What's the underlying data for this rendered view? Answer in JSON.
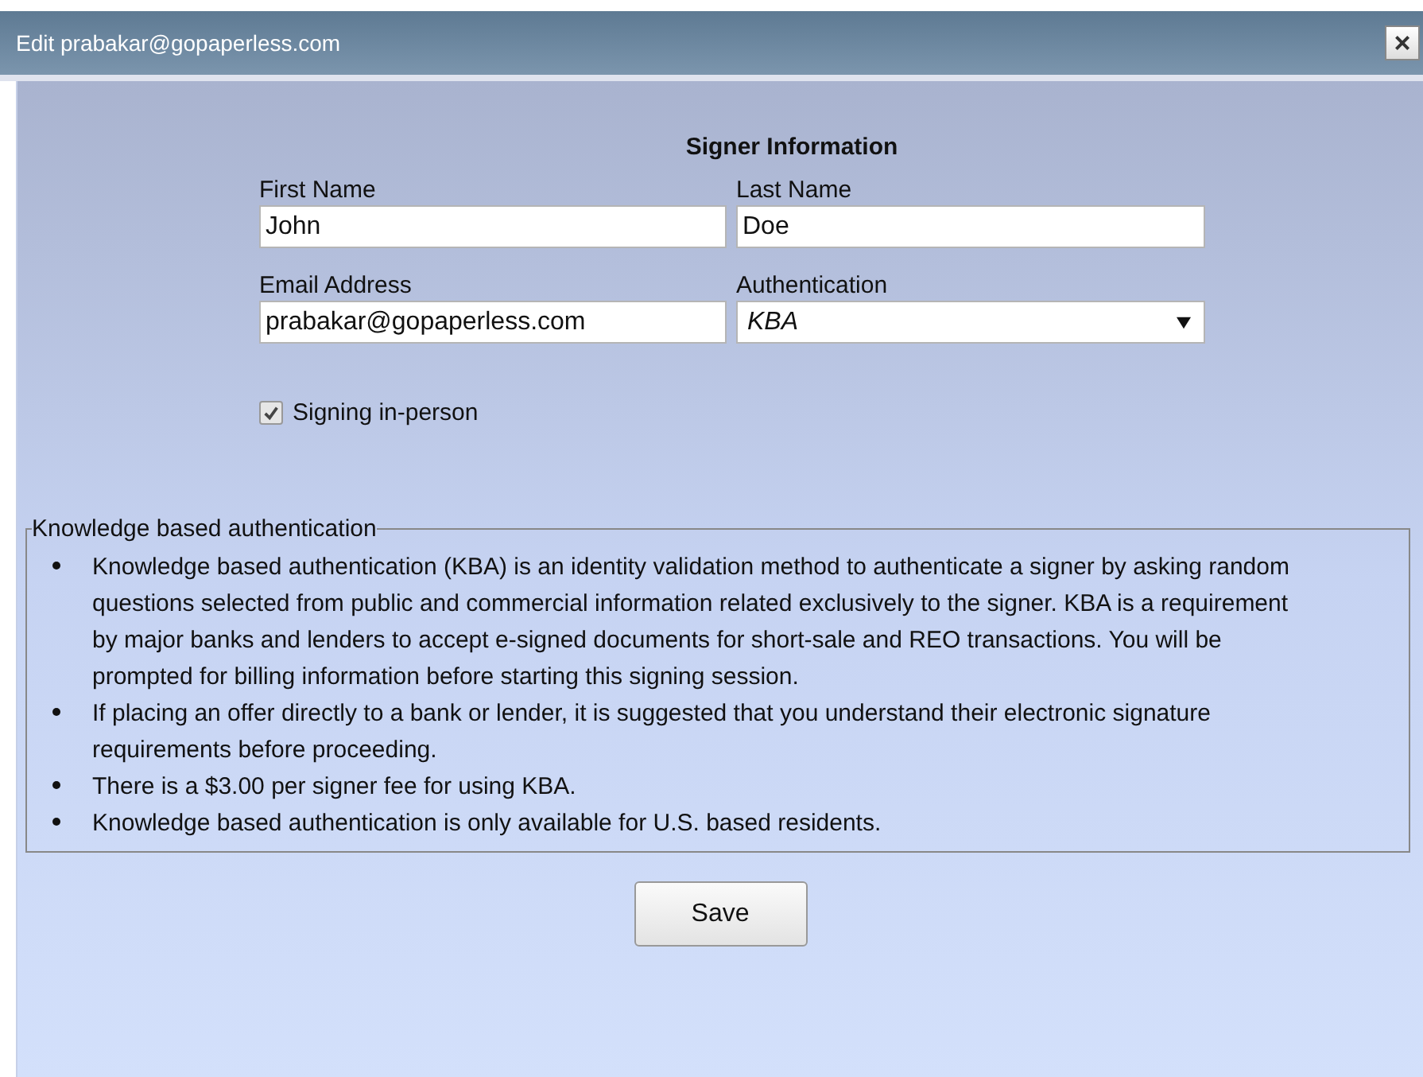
{
  "window": {
    "title": "Edit prabakar@gopaperless.com",
    "close": "×"
  },
  "section_title": "Signer Information",
  "fields": [
    {
      "label": "First Name",
      "value": "John",
      "kind": "text"
    },
    {
      "label": "Last Name",
      "value": "Doe",
      "kind": "text"
    },
    {
      "label": "Email Address",
      "value": "prabakar@gopaperless.com",
      "kind": "text"
    },
    {
      "label": "Authentication",
      "value": "KBA",
      "kind": "dropdown"
    }
  ],
  "signing_in_person": {
    "label": "Signing in-person",
    "checked": true
  },
  "info": {
    "legend": "Knowledge based authentication",
    "items": [
      "Knowledge based authentication (KBA) is an identity validation method to authenticate a signer by asking random questions selected from public and commercial information related exclusively to the signer. KBA is a requirement by major banks and lenders to accept e-signed documents for short-sale and REO transactions. You will be prompted for billing information before starting this signing session.",
      "If placing an offer directly to a bank or lender, it is suggested that you understand their electronic signature requirements before proceeding.",
      "There is a $3.00 per signer fee for using KBA.",
      "Knowledge based authentication is only available for U.S. based residents."
    ]
  },
  "buttons": [
    "Save"
  ]
}
